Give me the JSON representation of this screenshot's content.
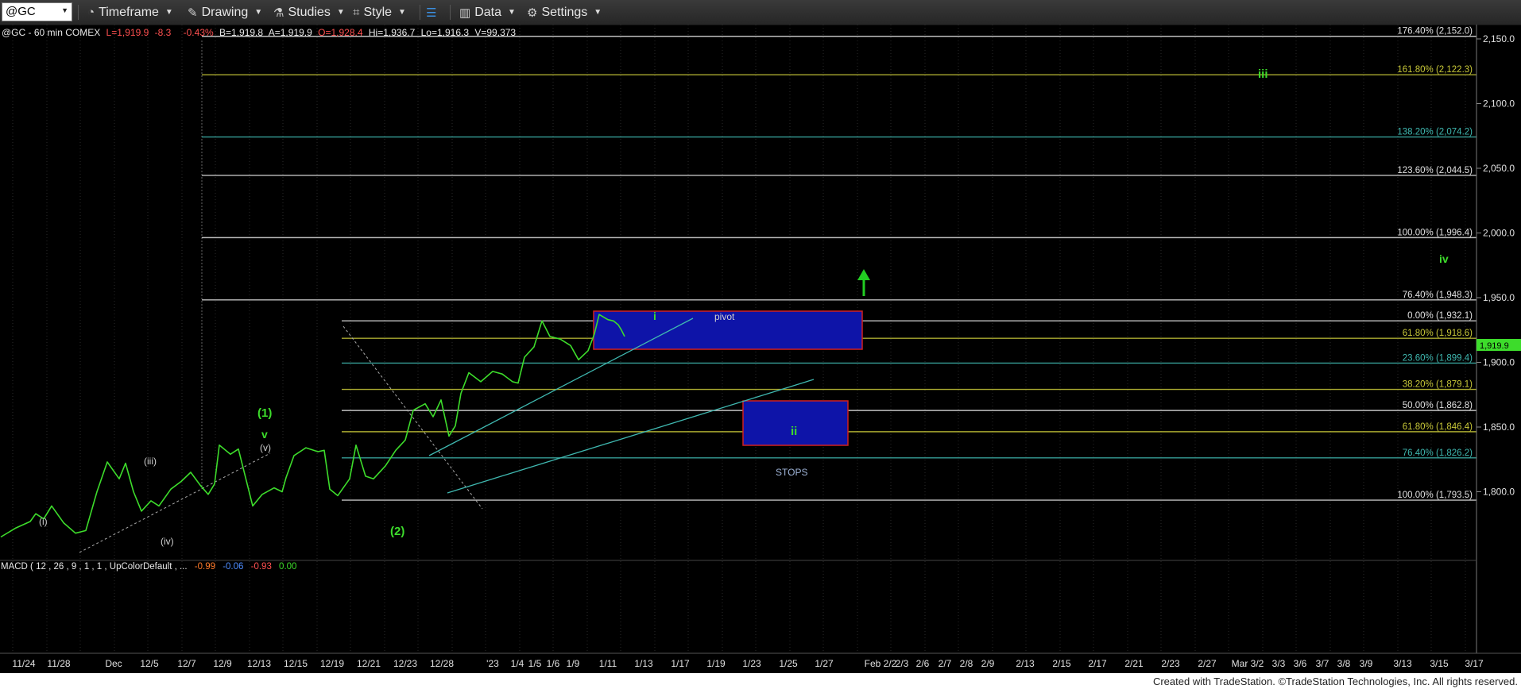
{
  "toolbar": {
    "symbol": "@GC",
    "timeframe": "Timeframe",
    "drawing": "Drawing",
    "studies": "Studies",
    "style": "Style",
    "data": "Data",
    "settings": "Settings"
  },
  "header": {
    "title": "@GC - 60 min  COMEX",
    "last": "L=1,919.9",
    "change": "-8.3",
    "pct": "-0.43%",
    "bid": "B=1,919.8",
    "ask": "A=1,919.9",
    "open": "O=1,928.4",
    "high": "Hi=1,936.7",
    "low": "Lo=1,916.3",
    "volume": "V=99,373"
  },
  "macd": {
    "label": "MACD ( 12 , 26 , 9 , 1 , 1 , UpColorDefault , ...",
    "v1": "-0.99",
    "v2": "-0.06",
    "v3": "-0.93",
    "v4": "0.00"
  },
  "chart_data": {
    "type": "line",
    "instrument": "@GC - 60 min COMEX",
    "ylim": [
      1760,
      2160
    ],
    "y_ticks": [
      "2,150.0",
      "2,100.0",
      "2,050.0",
      "2,000.0",
      "1,950.0",
      "1,900.0",
      "1,850.0",
      "1,800.0"
    ],
    "last_price": "1,919.9",
    "x_ticks": [
      "11/24",
      "11/28",
      "Dec",
      "12/5",
      "12/7",
      "12/9",
      "12/13",
      "12/15",
      "12/19",
      "12/21",
      "12/23",
      "12/28",
      "'23",
      "1/4",
      "1/5",
      "1/6",
      "1/9",
      "1/11",
      "1/13",
      "1/17",
      "1/19",
      "1/23",
      "1/25",
      "1/27",
      "Feb 2/2",
      "2/3",
      "2/6",
      "2/7",
      "2/8",
      "2/9",
      "2/13",
      "2/15",
      "2/17",
      "2/21",
      "2/23",
      "2/27",
      "Mar 3/2",
      "3/3",
      "3/6",
      "3/7",
      "3/8",
      "3/9",
      "3/13",
      "3/15",
      "3/17"
    ],
    "price_path": [
      [
        1,
        1765
      ],
      [
        20,
        1772
      ],
      [
        38,
        1777
      ],
      [
        45,
        1783
      ],
      [
        55,
        1779
      ],
      [
        65,
        1789
      ],
      [
        80,
        1776
      ],
      [
        95,
        1768
      ],
      [
        108,
        1770
      ],
      [
        122,
        1800
      ],
      [
        135,
        1823
      ],
      [
        150,
        1810
      ],
      [
        158,
        1822
      ],
      [
        168,
        1800
      ],
      [
        178,
        1785
      ],
      [
        190,
        1793
      ],
      [
        200,
        1789
      ],
      [
        215,
        1802
      ],
      [
        228,
        1808
      ],
      [
        240,
        1815
      ],
      [
        252,
        1805
      ],
      [
        262,
        1798
      ],
      [
        270,
        1806
      ],
      [
        276,
        1836
      ],
      [
        290,
        1829
      ],
      [
        300,
        1833
      ],
      [
        318,
        1789
      ],
      [
        330,
        1798
      ],
      [
        345,
        1803
      ],
      [
        355,
        1800
      ],
      [
        360,
        1811
      ],
      [
        370,
        1828
      ],
      [
        385,
        1834
      ],
      [
        400,
        1831
      ],
      [
        408,
        1832
      ],
      [
        415,
        1802
      ],
      [
        425,
        1797
      ],
      [
        440,
        1810
      ],
      [
        448,
        1836
      ],
      [
        460,
        1812
      ],
      [
        470,
        1810
      ],
      [
        485,
        1820
      ],
      [
        498,
        1832
      ],
      [
        510,
        1840
      ],
      [
        520,
        1863
      ],
      [
        535,
        1868
      ],
      [
        545,
        1858
      ],
      [
        555,
        1871
      ],
      [
        565,
        1843
      ],
      [
        573,
        1851
      ],
      [
        580,
        1876
      ],
      [
        590,
        1892
      ],
      [
        605,
        1885
      ],
      [
        620,
        1893
      ],
      [
        632,
        1891
      ],
      [
        645,
        1885
      ],
      [
        652,
        1884
      ],
      [
        660,
        1904
      ],
      [
        672,
        1912
      ],
      [
        682,
        1932
      ],
      [
        692,
        1920
      ],
      [
        705,
        1918
      ],
      [
        718,
        1913
      ],
      [
        728,
        1902
      ],
      [
        740,
        1909
      ],
      [
        748,
        1922
      ],
      [
        754,
        1937
      ],
      [
        765,
        1933
      ],
      [
        772,
        1932
      ],
      [
        778,
        1929
      ],
      [
        782,
        1925
      ],
      [
        786,
        1920
      ]
    ],
    "fib_levels": [
      {
        "label": "176.40% (2,152.0)",
        "value": 2152.0,
        "color": "#e0e0e0"
      },
      {
        "label": "161.80% (2,122.3)",
        "value": 2122.3,
        "color": "#c8c838"
      },
      {
        "label": "138.20% (2,074.2)",
        "value": 2074.2,
        "color": "#3fb8b0"
      },
      {
        "label": "123.60% (2,044.5)",
        "value": 2044.5,
        "color": "#e0e0e0"
      },
      {
        "label": "100.00% (1,996.4)",
        "value": 1996.4,
        "color": "#e0e0e0"
      },
      {
        "label": "76.40% (1,948.3)",
        "value": 1948.3,
        "color": "#e0e0e0"
      },
      {
        "label": "0.00% (1,932.1)",
        "value": 1932.1,
        "color": "#e0e0e0"
      },
      {
        "label": "61.80% (1,918.6)",
        "value": 1918.6,
        "color": "#c8c838"
      },
      {
        "label": "23.60% (1,899.4)",
        "value": 1899.4,
        "color": "#3fb8b0"
      },
      {
        "label": "38.20% (1,879.1)",
        "value": 1879.1,
        "color": "#c8c838"
      },
      {
        "label": "50.00% (1,862.8)",
        "value": 1862.8,
        "color": "#e0e0e0"
      },
      {
        "label": "61.80% (1,846.4)",
        "value": 1846.4,
        "color": "#c8c838"
      },
      {
        "label": "76.40% (1,826.2)",
        "value": 1826.2,
        "color": "#3fb8b0"
      },
      {
        "label": "100.00% (1,793.5)",
        "value": 1793.5,
        "color": "#e0e0e0"
      }
    ],
    "annotations": {
      "wave_i": "i",
      "wave_ii": "ii",
      "wave_iii": "iii",
      "wave_iv": "iv",
      "pivot": "pivot",
      "stops": "STOPS",
      "wave_1": "(1)",
      "wave_2": "(2)",
      "wave_v": "v",
      "sub_i": "(i)",
      "sub_iii": "(iii)",
      "sub_iv": "(iv)",
      "sub_v": "(v)"
    },
    "colors": {
      "price": "#3ddc2b",
      "label_green": "#3ddc2b",
      "label_white": "#cfcfcf",
      "box_fill": "#0e14a8",
      "box_border": "#d02020",
      "trendline": "#3fb8b0",
      "up_arrow": "#22cc22"
    }
  },
  "footer": "Created with TradeStation. ©TradeStation Technologies, Inc. All rights reserved."
}
